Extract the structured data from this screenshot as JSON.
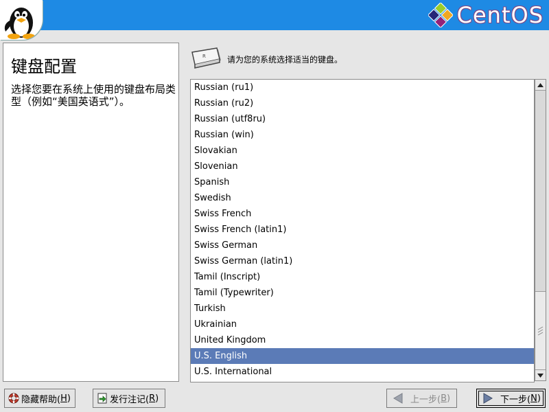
{
  "header": {
    "logo_text": "CentOS"
  },
  "help": {
    "title": "键盘配置",
    "text": "选择您要在系统上使用的键盘布局类型（例如“美国英语式”）。"
  },
  "prompt": {
    "text": "请为您的系统选择适当的键盘。"
  },
  "keyboard_list": {
    "items": [
      "Russian (ru1)",
      "Russian (ru2)",
      "Russian (utf8ru)",
      "Russian (win)",
      "Slovakian",
      "Slovenian",
      "Spanish",
      "Swedish",
      "Swiss French",
      "Swiss French (latin1)",
      "Swiss German",
      "Swiss German (latin1)",
      "Tamil (Inscript)",
      "Tamil (Typewriter)",
      "Turkish",
      "Ukrainian",
      "United Kingdom",
      "U.S. English",
      "U.S. International"
    ],
    "selected": "U.S. English"
  },
  "buttons": {
    "help_label": "隐藏帮助(",
    "help_key": "H",
    "notes_label": "发行注记(",
    "notes_key": "R",
    "back_label": "上一步(",
    "back_key": "B",
    "next_label": "下一步(",
    "next_key": "N",
    "close_paren": ")"
  },
  "colors": {
    "header": "#1e8ae4",
    "selection": "#5b7bb7"
  },
  "icons": {
    "penguin": "tux-penguin-icon",
    "logo": "centos-logo-icon",
    "keyboard": "keyboard-key-icon",
    "help": "lifebuoy-icon",
    "notes": "release-notes-icon",
    "back": "arrow-left-icon",
    "next": "arrow-right-icon"
  }
}
